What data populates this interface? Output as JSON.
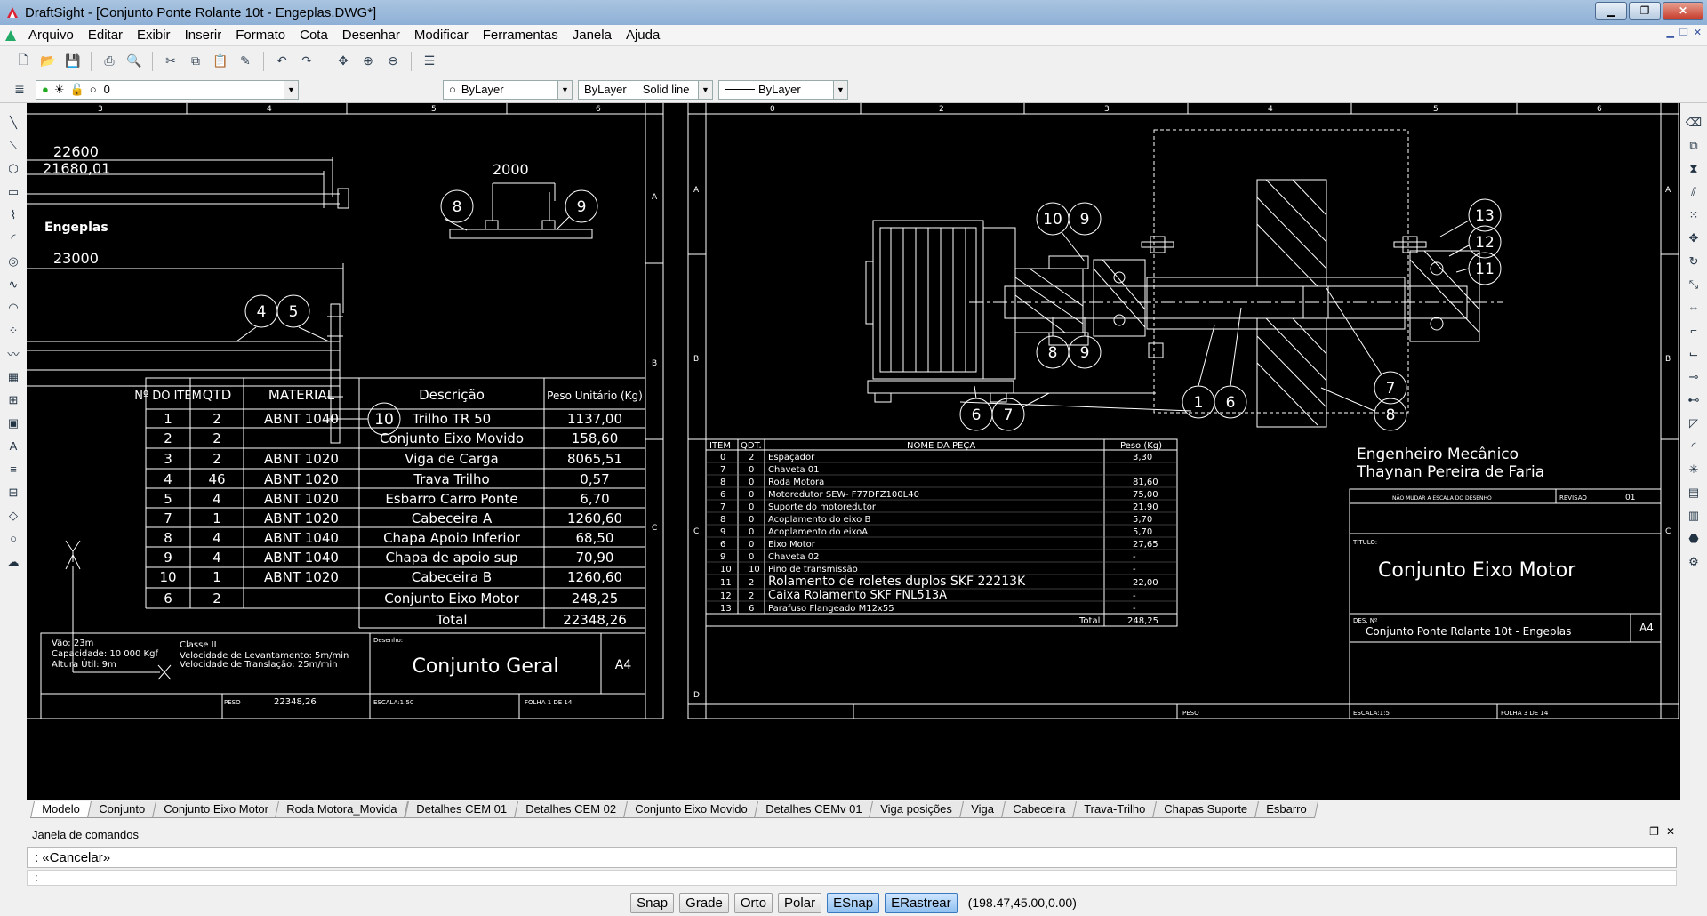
{
  "window": {
    "title": "DraftSight - [Conjunto Ponte Rolante 10t - Engeplas.DWG*]"
  },
  "menu": [
    "Arquivo",
    "Editar",
    "Exibir",
    "Inserir",
    "Formato",
    "Cota",
    "Desenhar",
    "Modificar",
    "Ferramentas",
    "Janela",
    "Ajuda"
  ],
  "layer": {
    "name": "0"
  },
  "props": {
    "color": "ByLayer",
    "linetype_scope": "ByLayer",
    "linetype": "Solid line",
    "lineweight": "ByLayer"
  },
  "drawing_left": {
    "dims": [
      "22600",
      "21680,01",
      "23000",
      "2000"
    ],
    "logo_text": "Engeplas",
    "balloons": [
      "8",
      "9",
      "4",
      "5",
      "10"
    ],
    "table_headers": [
      "Nº DO ITEM",
      "QTD",
      "MATERIAL",
      "Descrição",
      "Peso Unitário (Kg)"
    ],
    "rows": [
      {
        "item": "1",
        "qtd": "2",
        "mat": "ABNT 1040",
        "desc": "Trilho TR 50",
        "peso": "1137,00"
      },
      {
        "item": "2",
        "qtd": "2",
        "mat": "",
        "desc": "Conjunto Eixo Movido",
        "peso": "158,60"
      },
      {
        "item": "3",
        "qtd": "2",
        "mat": "ABNT 1020",
        "desc": "Viga de Carga",
        "peso": "8065,51"
      },
      {
        "item": "4",
        "qtd": "46",
        "mat": "ABNT 1020",
        "desc": "Trava Trilho",
        "peso": "0,57"
      },
      {
        "item": "5",
        "qtd": "4",
        "mat": "ABNT 1020",
        "desc": "Esbarro Carro Ponte",
        "peso": "6,70"
      },
      {
        "item": "7",
        "qtd": "1",
        "mat": "ABNT 1020",
        "desc": "Cabeceira A",
        "peso": "1260,60"
      },
      {
        "item": "8",
        "qtd": "4",
        "mat": "ABNT 1040",
        "desc": "Chapa Apoio Inferior",
        "peso": "68,50"
      },
      {
        "item": "9",
        "qtd": "4",
        "mat": "ABNT 1040",
        "desc": "Chapa de apoio sup",
        "peso": "70,90"
      },
      {
        "item": "10",
        "qtd": "1",
        "mat": "ABNT 1020",
        "desc": "Cabeceira B",
        "peso": "1260,60"
      },
      {
        "item": "6",
        "qtd": "2",
        "mat": "",
        "desc": "Conjunto Eixo Motor",
        "peso": "248,25"
      }
    ],
    "total_label": "Total",
    "total_value": "22348,26",
    "spec": [
      "Vão: 23m",
      "Capacidade: 10 000 Kgf",
      "Altura Útil: 9m",
      "Classe II",
      "Velocidade de Levantamento: 5m/min",
      "Velocidade de Translação: 25m/min"
    ],
    "title_label": "Desenho:",
    "title": "Conjunto Geral",
    "sheet": "A4",
    "peso_label": "PESO",
    "peso": "22348,26",
    "escala": "ESCALA:1:50",
    "folha": "FOLHA 1 DE 14"
  },
  "drawing_right": {
    "balloons": [
      "10",
      "9",
      "13",
      "12",
      "11",
      "8",
      "9",
      "6",
      "7",
      "1",
      "6",
      "7",
      "8"
    ],
    "bom_headers": [
      "ITEM",
      "QDT.",
      "NOME DA PEÇA",
      "Peso (Kg)"
    ],
    "bom": [
      {
        "item": "0",
        "qtd": "2",
        "nome": "Espaçador",
        "peso": "3,30"
      },
      {
        "item": "7",
        "qtd": "0",
        "nome": "Chaveta 01",
        "peso": ""
      },
      {
        "item": "8",
        "qtd": "0",
        "nome": "Roda Motora",
        "peso": "81,60"
      },
      {
        "item": "6",
        "qtd": "0",
        "nome": "Motoredutor SEW- F77DFZ100L40",
        "peso": "75,00"
      },
      {
        "item": "7",
        "qtd": "0",
        "nome": "Suporte do motoredutor",
        "peso": "21,90"
      },
      {
        "item": "8",
        "qtd": "0",
        "nome": "Acoplamento do eixo B",
        "peso": "5,70"
      },
      {
        "item": "9",
        "qtd": "0",
        "nome": "Acoplamento do eixoA",
        "peso": "5,70"
      },
      {
        "item": "6",
        "qtd": "0",
        "nome": "Eixo  Motor",
        "peso": "27,65"
      },
      {
        "item": "9",
        "qtd": "0",
        "nome": "Chaveta 02",
        "peso": "-"
      },
      {
        "item": "10",
        "qtd": "10",
        "nome": "Pino de transmissão",
        "peso": "-"
      },
      {
        "item": "11",
        "qtd": "2",
        "nome": "Rolamento de roletes duplos SKF 22213K",
        "peso": "22,00"
      },
      {
        "item": "12",
        "qtd": "2",
        "nome": "Caixa Rolamento SKF FNL513A",
        "peso": "-"
      },
      {
        "item": "13",
        "qtd": "6",
        "nome": "Parafuso Flangeado M12x55",
        "peso": "-"
      }
    ],
    "total_label": "Total",
    "total": "248,25",
    "engineer_title": "Engenheiro Mecânico",
    "engineer_name": "Thaynan Pereira de Faria",
    "note": "NÃO MUDAR A ESCALA DO DESENHO",
    "revision_label": "REVISÃO",
    "revision": "01",
    "title_label": "TÍTULO:",
    "title": "Conjunto Eixo Motor",
    "des_label": "DES. Nº",
    "des": "Conjunto Ponte Rolante 10t - Engeplas",
    "sheet": "A4",
    "peso_label": "PESO",
    "escala": "ESCALA:1:5",
    "folha": "FOLHA 3 DE 14"
  },
  "tabs": [
    "Modelo",
    "Conjunto",
    "Conjunto Eixo Motor",
    "Roda Motora_Movida",
    "Detalhes CEM 01",
    "Detalhes CEM 02",
    "Conjunto Eixo Movido",
    "Detalhes CEMv 01",
    "Viga posições",
    "Viga",
    "Cabeceira",
    "Trava-Trilho",
    "Chapas Suporte",
    "Esbarro"
  ],
  "command": {
    "header": "Janela de comandos",
    "output": ": «Cancelar»",
    "prompt": ":"
  },
  "status": {
    "buttons": [
      "Snap",
      "Grade",
      "Orto",
      "Polar",
      "ESnap",
      "ERastrear"
    ],
    "coords": "(198.47,45.00,0.00)"
  }
}
